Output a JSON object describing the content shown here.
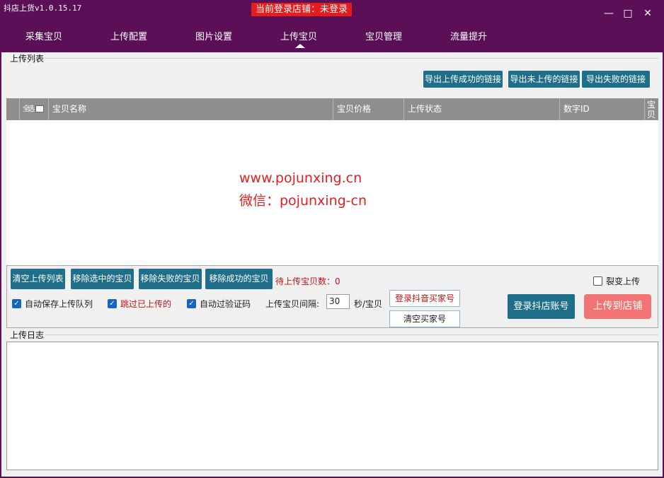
{
  "titlebar": {
    "app_title": "抖店上货v1.0.15.17",
    "login_status": "当前登录店铺：未登录",
    "minimize_glyph": "—",
    "maximize_glyph": "□",
    "close_glyph": "✕"
  },
  "nav": {
    "items": [
      {
        "label": "采集宝贝"
      },
      {
        "label": "上传配置"
      },
      {
        "label": "图片设置"
      },
      {
        "label": "上传宝贝"
      },
      {
        "label": "宝贝管理"
      },
      {
        "label": "流量提升"
      }
    ],
    "active_item": "上传宝贝"
  },
  "upload_list": {
    "label": "上传列表",
    "export_buttons": [
      "导出上传成功的链接",
      "导出未上传的链接",
      "导出失败的链接"
    ],
    "columns": [
      "全选",
      "宝贝名称",
      "宝贝价格",
      "上传状态",
      "数字ID",
      "宝贝"
    ],
    "rows": []
  },
  "watermark": {
    "line1": "www.pojunxing.cn",
    "line2": "微信：pojunxing-cn"
  },
  "controls": {
    "action_buttons": [
      "清空上传列表",
      "移除选中的宝贝",
      "移除失败的宝贝",
      "移除成功的宝贝"
    ],
    "pending_label": "待上传宝贝数：",
    "pending_count": "0",
    "fission_upload": {
      "label": "裂变上传",
      "checked": false
    },
    "checkboxes": [
      {
        "label": "自动保存上传队列",
        "checked": true
      },
      {
        "label": "跳过已上传的",
        "checked": true
      },
      {
        "label": "自动过验证码",
        "checked": true
      }
    ],
    "interval_label": "上传宝贝间隔:",
    "interval_value": "30",
    "interval_unit": "秒/宝贝",
    "login_buyer_button": "登录抖音买家号",
    "clear_buyer_button": "清空买家号",
    "login_shop_button": "登录抖店账号",
    "upload_to_store_button": "上传到店铺"
  },
  "upload_log": {
    "label": "上传日志",
    "content": ""
  },
  "colors": {
    "titlebar_bg": "#5a0f57",
    "primary_button": "#1f6f8b",
    "upload_button": "#f27373",
    "alert_red": "#e41c1c"
  }
}
